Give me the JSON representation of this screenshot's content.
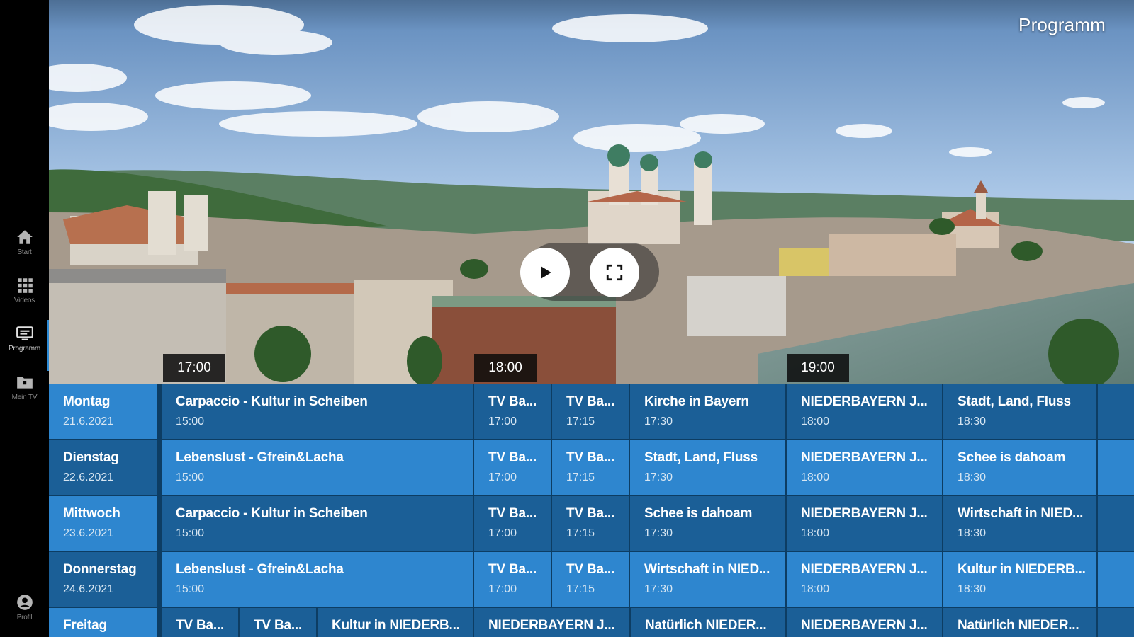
{
  "sidebar": {
    "items": [
      {
        "label": "Start",
        "icon": "home-icon"
      },
      {
        "label": "Videos",
        "icon": "grid-icon"
      },
      {
        "label": "Programm",
        "icon": "tv-icon"
      },
      {
        "label": "Mein TV",
        "icon": "folder-icon"
      },
      {
        "label": "Profil",
        "icon": "profile-icon"
      }
    ],
    "active_index": 2
  },
  "hero": {
    "title": "Programm",
    "play_icon": "play-icon",
    "fullscreen_icon": "fullscreen-icon"
  },
  "timeline": {
    "markers": [
      "17:00",
      "18:00",
      "19:00"
    ]
  },
  "colors": {
    "accent": "#2e86cf",
    "accent_dark": "#1b5f97",
    "grid_gap": "#0d3d63"
  },
  "schedule": [
    {
      "day": "Montag",
      "date": "21.6.2021",
      "programs": [
        {
          "title": "Carpaccio - Kultur in Scheiben",
          "time": "15:00"
        },
        {
          "title": "TV Ba...",
          "time": "17:00"
        },
        {
          "title": "TV Ba...",
          "time": "17:15"
        },
        {
          "title": "Kirche in Bayern",
          "time": "17:30"
        },
        {
          "title": "NIEDERBAYERN J...",
          "time": "18:00"
        },
        {
          "title": "Stadt, Land, Fluss",
          "time": "18:30"
        }
      ]
    },
    {
      "day": "Dienstag",
      "date": "22.6.2021",
      "programs": [
        {
          "title": "Lebenslust - Gfrein&Lacha",
          "time": "15:00"
        },
        {
          "title": "TV Ba...",
          "time": "17:00"
        },
        {
          "title": "TV Ba...",
          "time": "17:15"
        },
        {
          "title": "Stadt, Land, Fluss",
          "time": "17:30"
        },
        {
          "title": "NIEDERBAYERN J...",
          "time": "18:00"
        },
        {
          "title": "Schee is dahoam",
          "time": "18:30"
        }
      ]
    },
    {
      "day": "Mittwoch",
      "date": "23.6.2021",
      "programs": [
        {
          "title": "Carpaccio - Kultur in Scheiben",
          "time": "15:00"
        },
        {
          "title": "TV Ba...",
          "time": "17:00"
        },
        {
          "title": "TV Ba...",
          "time": "17:15"
        },
        {
          "title": "Schee is dahoam",
          "time": "17:30"
        },
        {
          "title": "NIEDERBAYERN J...",
          "time": "18:00"
        },
        {
          "title": "Wirtschaft in NIED...",
          "time": "18:30"
        }
      ]
    },
    {
      "day": "Donnerstag",
      "date": "24.6.2021",
      "programs": [
        {
          "title": "Lebenslust - Gfrein&Lacha",
          "time": "15:00"
        },
        {
          "title": "TV Ba...",
          "time": "17:00"
        },
        {
          "title": "TV Ba...",
          "time": "17:15"
        },
        {
          "title": "Wirtschaft in NIED...",
          "time": "17:30"
        },
        {
          "title": "NIEDERBAYERN J...",
          "time": "18:00"
        },
        {
          "title": "Kultur in NIEDERB...",
          "time": "18:30"
        }
      ]
    },
    {
      "day": "Freitag",
      "date": "",
      "programs": [
        {
          "title": "TV Ba...",
          "time": ""
        },
        {
          "title": "TV Ba...",
          "time": ""
        },
        {
          "title": "Kultur in NIEDERB...",
          "time": ""
        },
        {
          "title": "NIEDERBAYERN J...",
          "time": ""
        },
        {
          "title": "Natürlich NIEDER...",
          "time": ""
        },
        {
          "title": "NIEDERBAYERN J...",
          "time": ""
        },
        {
          "title": "Natürlich NIEDER...",
          "time": ""
        }
      ]
    }
  ]
}
